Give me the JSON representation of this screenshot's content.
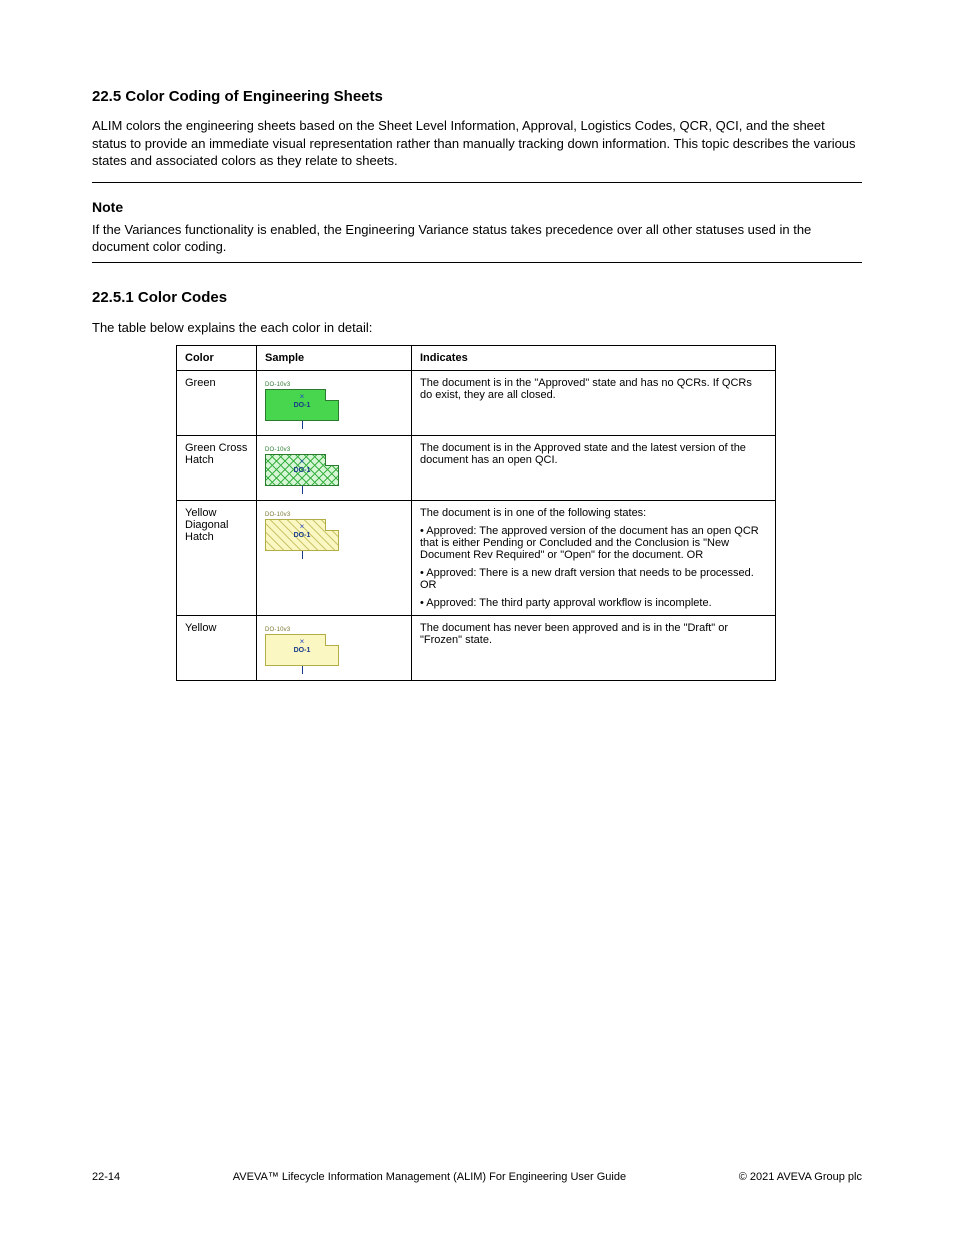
{
  "section_title": "22.5 Color Coding of Engineering Sheets",
  "intro": "ALIM colors the engineering sheets based on the Sheet Level Information, Approval, Logistics Codes, QCR, QCI, and the sheet status to provide an immediate visual representation rather than manually tracking down information. This topic describes the various states and associated colors as they relate to sheets.",
  "note_label": "Note",
  "note_body": "If the Variances functionality is enabled, the Engineering Variance status takes precedence over all other statuses used in the document color coding.",
  "sub_heading": "22.5.1 Color Codes",
  "lead_in": "The table below explains the each color in detail:",
  "headers": {
    "color": "Color",
    "sample": "Sample",
    "indicates": "Indicates"
  },
  "rows": [
    {
      "color": "Green",
      "swatch_top": "DO-10v3",
      "swatch_text": "DO-1",
      "indicates": "The document is in the \"Approved\" state and has no QCRs. If QCRs do exist, they are all closed."
    },
    {
      "color": "Green Cross Hatch",
      "swatch_top": "DO-10v3",
      "swatch_text": "DO-1",
      "indicates": "The document is in the Approved state and the latest version of the document has an open QCI."
    },
    {
      "color": "Yellow Diagonal Hatch",
      "swatch_top": "DO-10v3",
      "swatch_text": "DO-1",
      "indicates_lines": [
        "The document is in one of the following states:",
        "• Approved: The approved version of the document has an open QCR that is either Pending or Concluded and the Conclusion is \"New Document Rev Required\" or \"Open\" for the document. OR",
        "• Approved: There is a new draft version that needs to be processed. OR",
        "• Approved: The third party approval workflow is incomplete."
      ]
    },
    {
      "color": "Yellow",
      "swatch_top": "DO-10v3",
      "swatch_text": "DO-1",
      "indicates": "The document has never been approved and is in the \"Draft\" or \"Frozen\" state."
    }
  ],
  "footer": {
    "left": "22-14",
    "center": "AVEVA™ Lifecycle Information Management (ALIM) For Engineering User Guide",
    "right": "© 2021 AVEVA Group plc"
  }
}
